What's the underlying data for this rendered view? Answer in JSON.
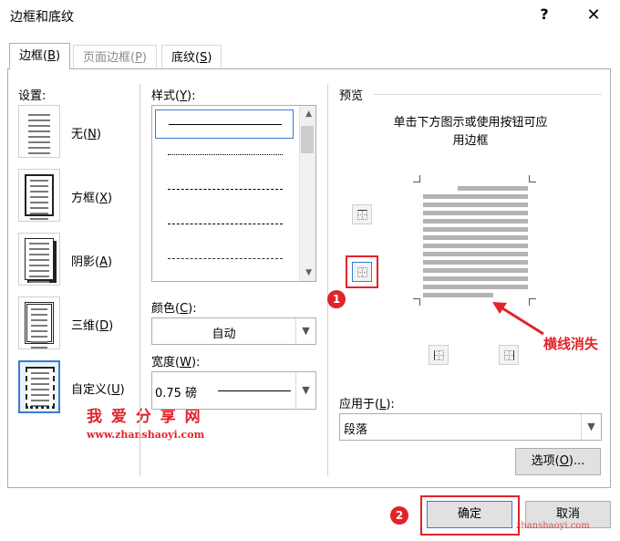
{
  "dialog": {
    "title": "边框和底纹",
    "help_icon": "?",
    "close_icon": "✕"
  },
  "tabs": [
    {
      "label": "边框(",
      "key": "B",
      "suffix": ")"
    },
    {
      "label": "页面边框(",
      "key": "P",
      "suffix": ")"
    },
    {
      "label": "底纹(",
      "key": "S",
      "suffix": ")"
    }
  ],
  "settings": {
    "title": "设置:",
    "items": [
      {
        "label": "无(",
        "key": "N",
        "suffix": ")"
      },
      {
        "label": "方框(",
        "key": "X",
        "suffix": ")"
      },
      {
        "label": "阴影(",
        "key": "A",
        "suffix": ")"
      },
      {
        "label": "三维(",
        "key": "D",
        "suffix": ")"
      },
      {
        "label": "自定义(",
        "key": "U",
        "suffix": ")"
      }
    ]
  },
  "style": {
    "title": "样式(",
    "key": "Y",
    "suffix": "):",
    "items": [
      "solid",
      "dotted",
      "dashed-small",
      "dashed",
      "dash-dot"
    ]
  },
  "color": {
    "title": "颜色(",
    "key": "C",
    "suffix": "):",
    "value": "自动"
  },
  "width": {
    "title": "宽度(",
    "key": "W",
    "suffix": "):",
    "value": "0.75 磅"
  },
  "preview": {
    "title": "预览",
    "hint_line1": "单击下方图示或使用按钮可应",
    "hint_line2": "用边框"
  },
  "apply_to": {
    "title": "应用于(",
    "key": "L",
    "suffix": "):",
    "value": "段落"
  },
  "buttons": {
    "options": "选项(",
    "options_key": "O",
    "options_suffix": ")...",
    "ok": "确定",
    "cancel": "取消"
  },
  "annotations": {
    "arrow_text": "横线消失",
    "badge1": "1",
    "badge2": "2",
    "watermark_cn": "我 爱 分 享 网",
    "watermark_url": "www.zhanshaoyi.com",
    "watermark_url2": "zhanshaoyi.com"
  },
  "colors": {
    "accent": "#3a7bd5",
    "annotation_red": "#e0242a"
  }
}
